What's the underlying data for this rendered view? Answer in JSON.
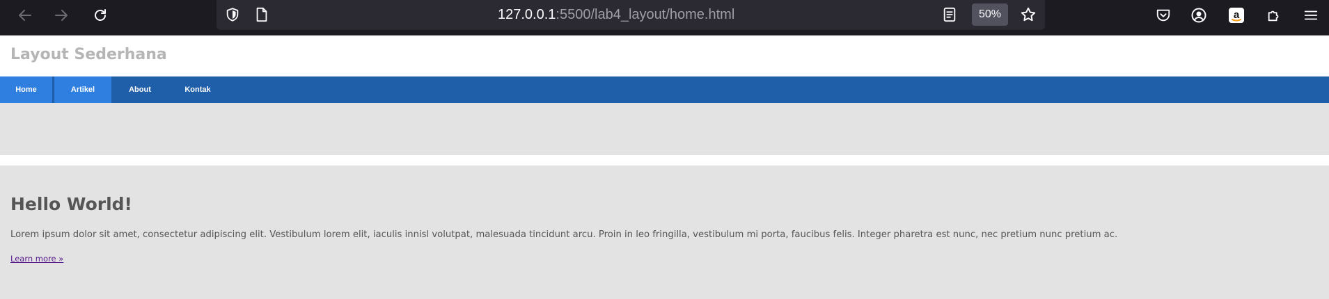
{
  "browser": {
    "url_host": "127.0.0.1",
    "url_rest": ":5500/lab4_layout/home.html",
    "zoom": "50%",
    "icons": {
      "back": "arrow-left-icon",
      "forward": "arrow-right-icon",
      "reload": "reload-icon",
      "tracking": "shield-icon",
      "page": "page-icon",
      "reader": "reader-view-icon",
      "bookmark": "star-icon",
      "pocket": "pocket-icon",
      "account": "account-icon",
      "amazon": "amazon-icon",
      "extensions": "puzzle-icon",
      "menu": "hamburger-menu-icon"
    }
  },
  "site": {
    "title": "Layout Sederhana"
  },
  "nav": {
    "items": [
      {
        "label": "Home",
        "active": true
      },
      {
        "label": "Artikel",
        "active": true
      },
      {
        "label": "About",
        "active": false
      },
      {
        "label": "Kontak",
        "active": false
      }
    ]
  },
  "main": {
    "heading": "Hello World!",
    "body": "Lorem ipsum dolor sit amet, consectetur adipiscing elit. Vestibulum lorem elit, iaculis innisl volutpat, malesuada tincidunt arcu. Proin in leo fringilla, vestibulum mi porta, faucibus felis. Integer pharetra est nunc, nec pretium nunc pretium ac.",
    "link": "Learn more »"
  },
  "colors": {
    "chrome_bg": "#1c1b22",
    "urlbar_bg": "#2b2a33",
    "nav_bg": "#1f5faa",
    "nav_active": "#2f7fe0",
    "panel_bg": "#e3e3e3",
    "link": "#551a8b"
  }
}
